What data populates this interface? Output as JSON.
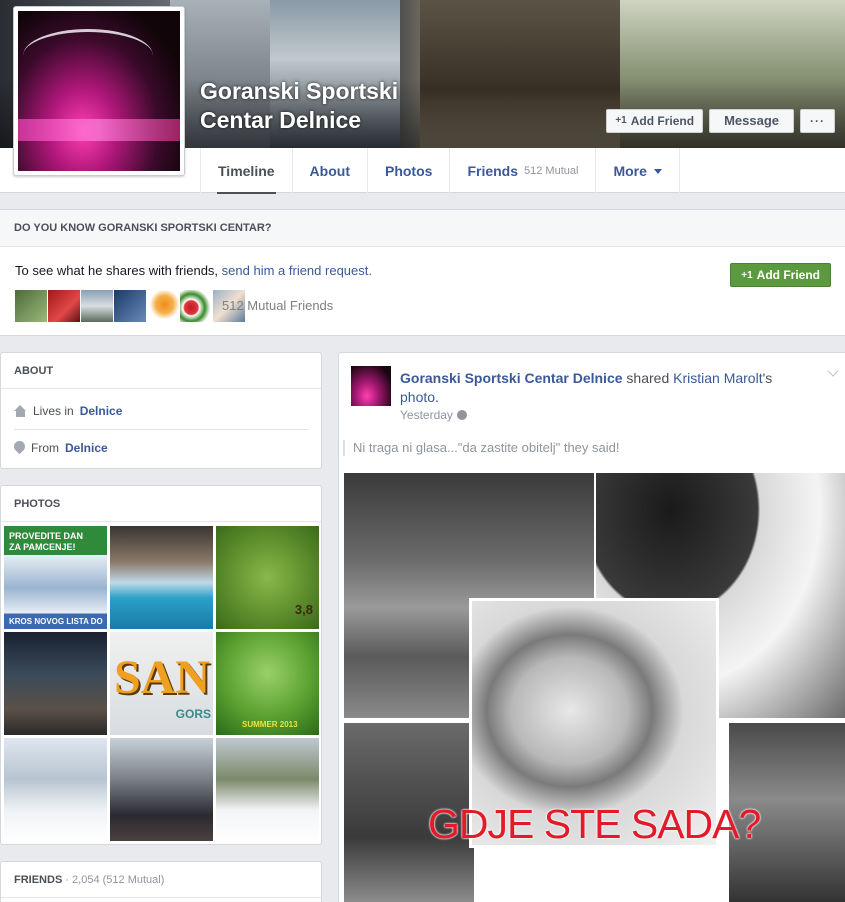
{
  "profile": {
    "name": "Goranski Sportski Centar Delnice",
    "add_friend_label": "Add Friend",
    "message_label": "Message",
    "more_label": "···",
    "plus_label": "+1"
  },
  "tabs": [
    {
      "label": "Timeline",
      "sub": ""
    },
    {
      "label": "About",
      "sub": ""
    },
    {
      "label": "Photos",
      "sub": ""
    },
    {
      "label": "Friends",
      "sub": "512 Mutual"
    },
    {
      "label": "More",
      "sub": ""
    }
  ],
  "know": {
    "heading": "DO YOU KNOW GORANSKI SPORTSKI CENTAR?",
    "text_prefix": "To see what he shares with friends, ",
    "text_link": "send him a friend request.",
    "button_label": "Add Friend",
    "mutual_label": "512 Mutual Friends"
  },
  "about": {
    "heading": "ABOUT",
    "lives_prefix": "Lives in ",
    "lives_place": "Delnice",
    "from_prefix": "From ",
    "from_place": "Delnice"
  },
  "photos": {
    "heading": "PHOTOS",
    "captions": {
      "p1_top": "PROVEDITE DAN ZA PAMCENJE!",
      "p1_bottom": "KROS NOVOG LISTA DO",
      "p3": "3,8",
      "p5": "SAN",
      "p5_sub": "GORS",
      "p6": "SUMMER 2013"
    }
  },
  "friends": {
    "heading": "FRIENDS",
    "count": " · 2,054 (512 Mutual)"
  },
  "post": {
    "author": "Goranski Sportski Centar Delnice",
    "shared_word": " shared ",
    "shared_from": "Kristian Marolt",
    "possessive": "'s",
    "object": "photo",
    "period": ".",
    "time": "Yesterday",
    "text": "Ni traga ni glasa...\"da zastite obitelj\" they said!",
    "image_caption": "GDJE STE SADA?"
  },
  "colors": {
    "link": "#3b5998",
    "add_friend_green": "#5b9a3e",
    "caption_red": "#e21a2a"
  }
}
